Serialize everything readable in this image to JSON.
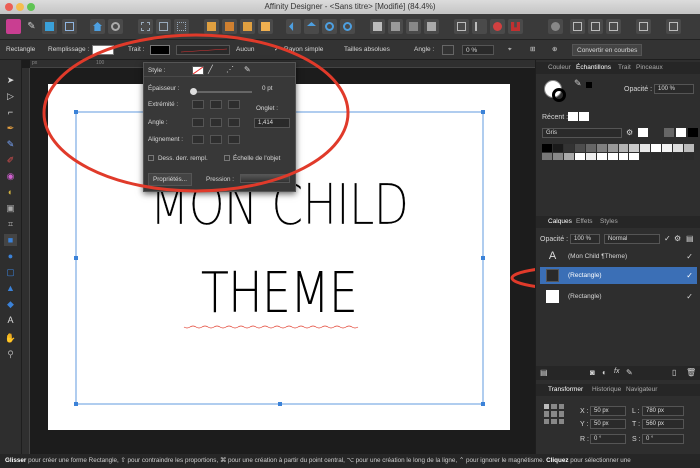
{
  "window": {
    "title": "Affinity Designer - <Sans titre> [Modifié] (84.4%)"
  },
  "context_bar": {
    "tool": "Rectangle",
    "fill_label": "Remplissage :",
    "stroke_label": "Trait :",
    "stroke_none": "Aucun",
    "corner_label": "Rayon simple",
    "absolute_sizes": "Tailles absolues",
    "angle_label": "Angle :",
    "angle_value": "0 %",
    "convert_button": "Convertir en courbes"
  },
  "ruler": {
    "unit": "px",
    "tick1": "100"
  },
  "stroke_popup": {
    "style_label": "Style :",
    "thickness_label": "Épaisseur :",
    "thickness_value": "0 pt",
    "cap_label": "Extrémité :",
    "join_label": "Angle :",
    "miter_label": "Onglet :",
    "miter_value": "1,414",
    "align_label": "Alignement :",
    "draw_behind": "Dess. derr. rempl.",
    "scale_with_object": "Échelle de l'objet",
    "properties_button": "Propriétés...",
    "pressure_label": "Pression :"
  },
  "canvas": {
    "line1": "MON CHILD",
    "line2": "THEME"
  },
  "swatch_panel": {
    "tabs": [
      "Couleur",
      "Échantillons",
      "Trait",
      "Pinceaux"
    ],
    "opacity_label": "Opacité :",
    "opacity_value": "100 %",
    "recent_label": "Récent :",
    "palette_name": "Gris"
  },
  "layers_panel": {
    "tabs": [
      "Calques",
      "Effets",
      "Styles"
    ],
    "opacity_label": "Opacité :",
    "opacity_value": "100 %",
    "blend_mode": "Normal",
    "layers": [
      {
        "name": "(Mon Child ¶Theme)",
        "icon": "text-icon"
      },
      {
        "name": "(Rectangle)",
        "icon": "rect-dark"
      },
      {
        "name": "(Rectangle)",
        "icon": "rect-white"
      }
    ]
  },
  "transform_panel": {
    "tabs": [
      "Transformer",
      "Historique",
      "Navigateur"
    ],
    "x_label": "X :",
    "x_value": "50 px",
    "y_label": "Y :",
    "y_value": "50 px",
    "w_label": "L :",
    "w_value": "780 px",
    "h_label": "T :",
    "h_value": "560 px",
    "r_label": "R :",
    "r_value": "0 °",
    "s_label": "S :",
    "s_value": "0 °"
  },
  "status": {
    "text_bold1": "Glisser",
    "text1": " pour créer une forme Rectangle, ⇧ pour contraindre les proportions, ⌘ pour une création à partir du point central, ⌥ pour une création le long de la ligne, ⌃ pour ignorer le magnétisme. ",
    "text_bold2": "Cliquez",
    "text2": " pour sélectionner une"
  },
  "colors": {
    "accent": "#3b82d8",
    "annotation": "#e03a2a",
    "selected_layer": "#3b6fb6"
  }
}
